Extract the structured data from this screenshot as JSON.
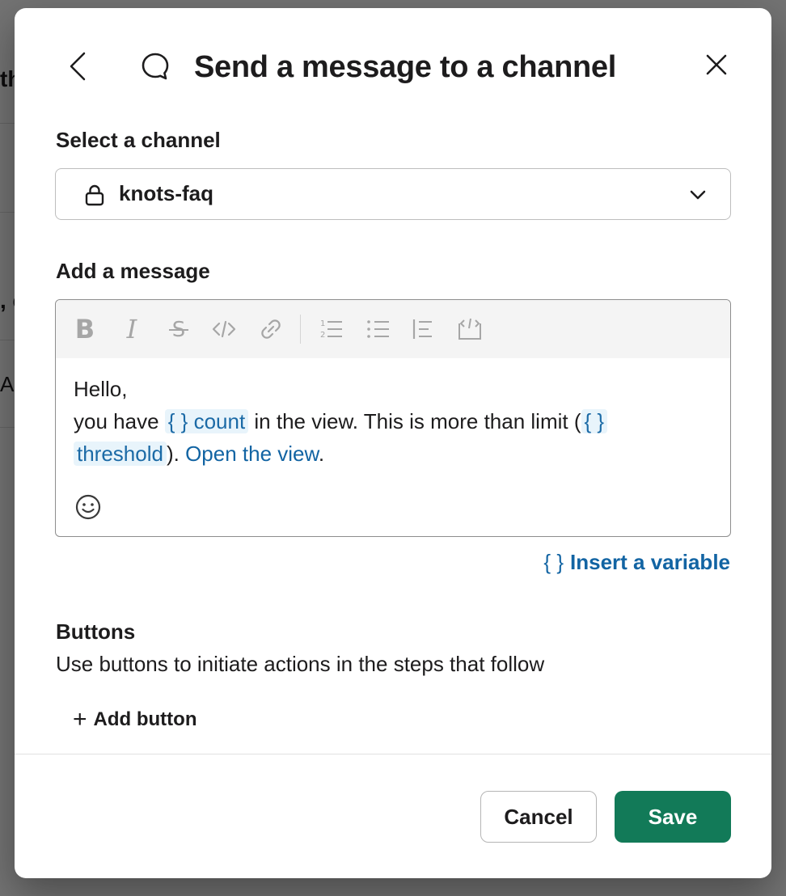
{
  "modal": {
    "title": "Send a message to a channel"
  },
  "channel": {
    "label": "Select a channel",
    "value": "knots-faq"
  },
  "message": {
    "label": "Add a message",
    "toolbar": [
      "bold",
      "italic",
      "strikethrough",
      "code",
      "link",
      "ordered-list",
      "bullet-list",
      "blockquote",
      "code-block"
    ],
    "greeting": "Hello,",
    "line2_a": "you have ",
    "var_count": "{ } count",
    "line2_b": " in the view. This is more than limit (",
    "var_threshold_a": "{ }",
    "var_threshold_b": "threshold",
    "line3_b": "). ",
    "link": "Open the view",
    "period": "."
  },
  "insert_variable": {
    "icon": "{ }",
    "label": "Insert a variable"
  },
  "buttons": {
    "label": "Buttons",
    "description": "Use buttons to initiate actions in the steps that follow",
    "add_icon": "+",
    "add_label": "Add button"
  },
  "footer": {
    "cancel": "Cancel",
    "save": "Save"
  },
  "colors": {
    "save_bg": "#127a58",
    "link": "#1264a3",
    "variable_bg": "#e8f4fb"
  }
}
